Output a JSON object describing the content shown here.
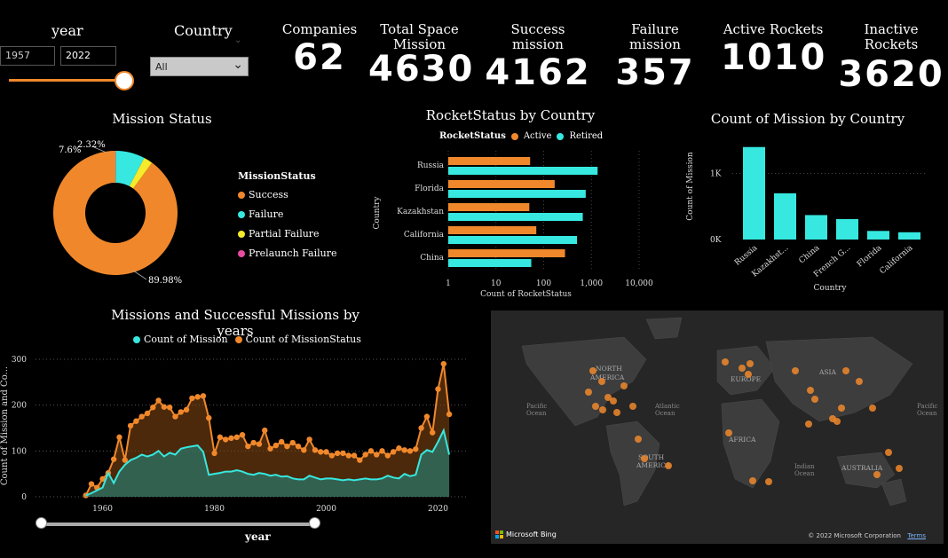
{
  "colors": {
    "orange": "#f0882b",
    "teal": "#36e8df",
    "yellow": "#f6ea2a",
    "pink": "#e84ca0",
    "map_bg": "#2a2a2a",
    "map_land": "#3d3d3d"
  },
  "slicers": {
    "year": {
      "title": "year",
      "from": "1957",
      "to": "2022"
    },
    "country": {
      "title": "Country",
      "selected": "All"
    }
  },
  "kpis": [
    {
      "title": "Companies",
      "value": "62"
    },
    {
      "title": "Total Space Mission",
      "value": "4630"
    },
    {
      "title": "Success mission",
      "value": "4162"
    },
    {
      "title": "Failure mission",
      "value": "357"
    },
    {
      "title": "Active Rockets",
      "value": "1010"
    },
    {
      "title": "Inactive Rockets",
      "value": "3620"
    }
  ],
  "mission_status": {
    "title": "Mission Status",
    "legend_title": "MissionStatus",
    "slices": [
      {
        "name": "Success",
        "value": 89.98,
        "label": "89.98%",
        "color": "#f0882b"
      },
      {
        "name": "Failure",
        "value": 7.6,
        "label": "7.6%",
        "color": "#36e8df"
      },
      {
        "name": "Partial Failure",
        "value": 2.32,
        "label": "2.32%",
        "color": "#f6ea2a"
      },
      {
        "name": "Prelaunch Failure",
        "value": 0.1,
        "label": "",
        "color": "#e84ca0"
      }
    ]
  },
  "rocket_status": {
    "title": "RocketStatus by Country",
    "legend_title": "RocketStatus",
    "legend": [
      "Active",
      "Retired"
    ],
    "ylabel": "Country",
    "xlabel": "Count of RocketStatus",
    "xticks": [
      "1",
      "10",
      "100",
      "1,000",
      "10,000"
    ]
  },
  "count_by_country": {
    "title": "Count of Mission by Country",
    "ylabel": "Count of Mission",
    "xlabel": "Country",
    "yticks": [
      "1K",
      "0K"
    ]
  },
  "line_chart": {
    "title": "Missions and Successful Missions by years",
    "legend": [
      "Count of Mission",
      "Count of MissionStatus"
    ],
    "ylabel": "Count of Mission and Co...",
    "xlabel": "year",
    "yticks": [
      "300",
      "200",
      "100",
      "0"
    ],
    "xticks": [
      "1960",
      "1980",
      "2000",
      "2020"
    ]
  },
  "map": {
    "labels": [
      {
        "text": "NORTH",
        "kind": "region"
      },
      {
        "text": "AMERICA",
        "kind": "region"
      },
      {
        "text": "EUROPE",
        "kind": "region"
      },
      {
        "text": "ASIA",
        "kind": "region"
      },
      {
        "text": "AFRICA",
        "kind": "region"
      },
      {
        "text": "SOUTH",
        "kind": "region"
      },
      {
        "text": "AMERICA",
        "kind": "region"
      },
      {
        "text": "AUSTRALIA",
        "kind": "region"
      },
      {
        "text": "Pacific",
        "kind": "ocean"
      },
      {
        "text": "Ocean",
        "kind": "ocean"
      },
      {
        "text": "Atlantic",
        "kind": "ocean"
      },
      {
        "text": "Ocean",
        "kind": "ocean"
      },
      {
        "text": "Indian",
        "kind": "ocean"
      },
      {
        "text": "Ocean",
        "kind": "ocean"
      },
      {
        "text": "Pacific",
        "kind": "ocean"
      },
      {
        "text": "Ocean",
        "kind": "ocean"
      }
    ],
    "bing": "Microsoft Bing",
    "copyright": "© 2022 Microsoft Corporation",
    "terms": "Terms"
  },
  "chart_data": [
    {
      "type": "pie",
      "title": "Mission Status",
      "categories": [
        "Success",
        "Failure",
        "Partial Failure",
        "Prelaunch Failure"
      ],
      "values": [
        89.98,
        7.6,
        2.32,
        0.1
      ]
    },
    {
      "type": "bar",
      "orientation": "horizontal",
      "title": "RocketStatus by Country",
      "categories": [
        "Russia",
        "Florida",
        "Kazakhstan",
        "California",
        "China"
      ],
      "series": [
        {
          "name": "Active",
          "values": [
            52,
            170,
            50,
            70,
            280
          ]
        },
        {
          "name": "Retired",
          "values": [
            1350,
            760,
            660,
            500,
            55
          ]
        }
      ],
      "xscale": "log",
      "xlim": [
        1,
        10000
      ],
      "xlabel": "Count of RocketStatus",
      "ylabel": "Country"
    },
    {
      "type": "bar",
      "title": "Count of Mission by Country",
      "categories": [
        "Russia",
        "Kazakhst...",
        "China",
        "French G...",
        "Florida",
        "California"
      ],
      "values": [
        1400,
        700,
        370,
        310,
        130,
        110
      ],
      "xlabel": "Country",
      "ylabel": "Count of Mission"
    },
    {
      "type": "area",
      "title": "Missions and Successful Missions by years",
      "x": [
        1957,
        1958,
        1959,
        1960,
        1961,
        1962,
        1963,
        1964,
        1965,
        1966,
        1967,
        1968,
        1969,
        1970,
        1971,
        1972,
        1973,
        1974,
        1975,
        1976,
        1977,
        1978,
        1979,
        1980,
        1981,
        1982,
        1983,
        1984,
        1985,
        1986,
        1987,
        1988,
        1989,
        1990,
        1991,
        1992,
        1993,
        1994,
        1995,
        1996,
        1997,
        1998,
        1999,
        2000,
        2001,
        2002,
        2003,
        2004,
        2005,
        2006,
        2007,
        2008,
        2009,
        2010,
        2011,
        2012,
        2013,
        2014,
        2015,
        2016,
        2017,
        2018,
        2019,
        2020,
        2021,
        2022
      ],
      "series": [
        {
          "name": "Count of Mission",
          "values": [
            3,
            8,
            14,
            20,
            52,
            30,
            55,
            70,
            80,
            85,
            92,
            88,
            92,
            100,
            88,
            96,
            92,
            105,
            108,
            110,
            112,
            98,
            48,
            50,
            52,
            55,
            55,
            58,
            55,
            50,
            48,
            52,
            50,
            46,
            48,
            44,
            45,
            40,
            38,
            38,
            46,
            42,
            38,
            40,
            40,
            38,
            36,
            38,
            36,
            38,
            40,
            38,
            38,
            40,
            46,
            42,
            40,
            50,
            45,
            48,
            92,
            102,
            98,
            120,
            145,
            92
          ]
        },
        {
          "name": "Count of MissionStatus",
          "values": [
            3,
            28,
            20,
            39,
            52,
            82,
            130,
            80,
            155,
            165,
            175,
            182,
            195,
            210,
            196,
            195,
            175,
            185,
            190,
            215,
            218,
            220,
            172,
            95,
            130,
            125,
            128,
            130,
            135,
            110,
            118,
            115,
            145,
            105,
            112,
            120,
            110,
            118,
            110,
            102,
            125,
            102,
            98,
            98,
            90,
            95,
            95,
            90,
            90,
            80,
            92,
            100,
            92,
            100,
            90,
            98,
            106,
            102,
            100,
            104,
            150,
            175,
            140,
            235,
            290,
            180
          ]
        }
      ],
      "xlim": [
        1957,
        2022
      ],
      "ylim": [
        0,
        300
      ],
      "xlabel": "year",
      "ylabel": "Count of Mission and Co..."
    }
  ]
}
